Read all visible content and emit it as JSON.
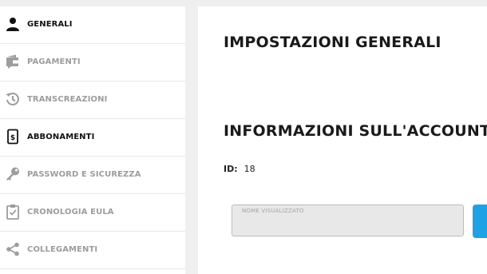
{
  "sidebar": {
    "items": [
      {
        "label": "GENERALI",
        "icon": "user-icon"
      },
      {
        "label": "PAGAMENTI",
        "icon": "wallet-icon"
      },
      {
        "label": "TRANSCREAZIONI",
        "icon": "history-icon"
      },
      {
        "label": "ABBONAMENTI",
        "icon": "receipt-icon"
      },
      {
        "label": "PASSWORD E SICUREZZA",
        "icon": "key-icon"
      },
      {
        "label": "CRONOLOGIA EULA",
        "icon": "clipboard-check-icon"
      },
      {
        "label": "COLLEGAMENTI",
        "icon": "share-icon"
      }
    ]
  },
  "main": {
    "title": "IMPOSTAZIONI GENERALI",
    "account_title": "INFORMAZIONI SULL'ACCOUNT",
    "id_label": "ID:",
    "id_value": "18",
    "display_name_placeholder": "NOME VISUALIZZATO",
    "display_name_value": ""
  },
  "colors": {
    "accent": "#1fa1e6",
    "active_text": "#111111",
    "inactive_text": "#9d9d9d"
  }
}
